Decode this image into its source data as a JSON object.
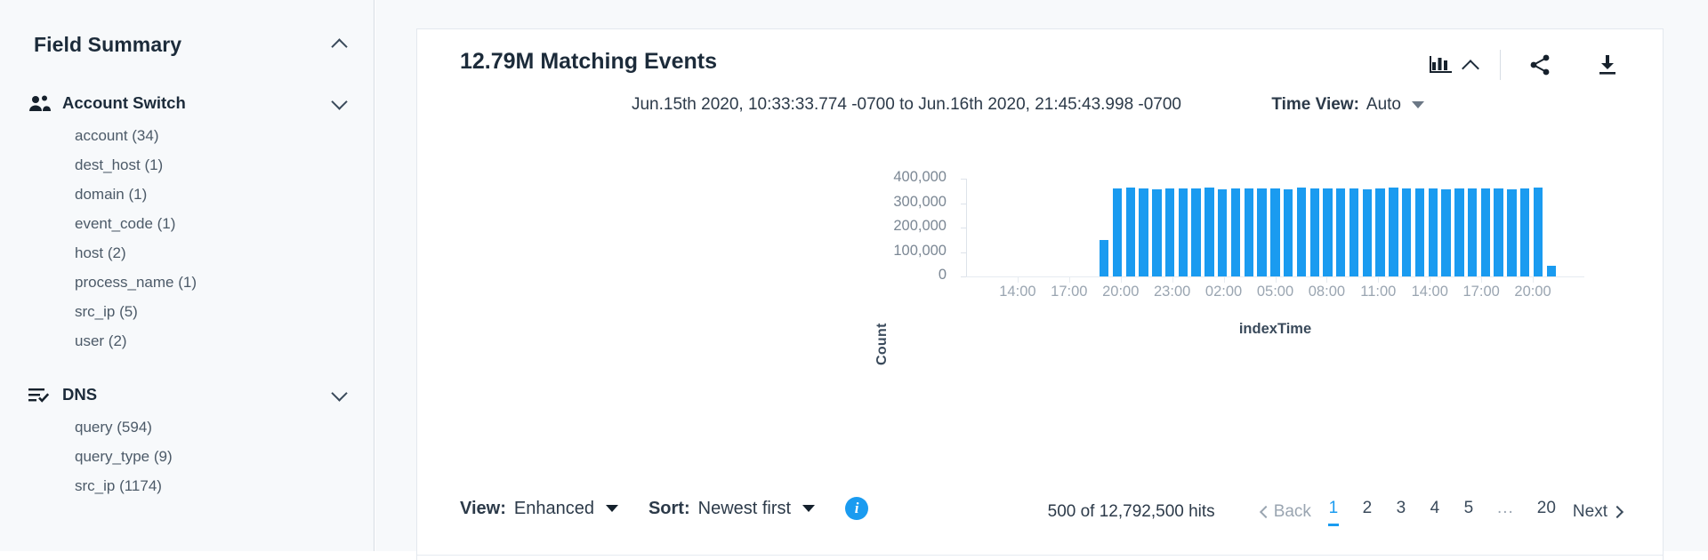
{
  "sidebar": {
    "title": "Field Summary",
    "title_toggle_icon": "chevron-up-icon",
    "groups": [
      {
        "label": "Account Switch",
        "icon": "people-icon",
        "toggle_icon": "chevron-down-icon",
        "fields": [
          "account (34)",
          "dest_host (1)",
          "domain (1)",
          "event_code (1)",
          "host (2)",
          "process_name (1)",
          "src_ip (5)",
          "user (2)"
        ]
      },
      {
        "label": "DNS",
        "icon": "list-check-icon",
        "toggle_icon": "chevron-down-icon",
        "fields": [
          "query (594)",
          "query_type (9)",
          "src_ip (1174)"
        ]
      }
    ]
  },
  "panel": {
    "title": "12.79M Matching Events",
    "tools": [
      {
        "name": "bar-chart-icon",
        "label": ""
      },
      {
        "name": "chevron-up-icon",
        "label": ""
      },
      {
        "name": "share-icon",
        "label": ""
      },
      {
        "name": "download-icon",
        "label": ""
      }
    ],
    "time_range": "Jun.15th 2020, 10:33:33.774 -0700 to Jun.16th 2020, 21:45:43.998 -0700",
    "time_view": {
      "label": "Time View:",
      "value": "Auto"
    }
  },
  "footer": {
    "view": {
      "label": "View:",
      "value": "Enhanced"
    },
    "sort": {
      "label": "Sort:",
      "value": "Newest first"
    },
    "info_icon": "info-icon",
    "info_glyph": "i",
    "hits": "500 of 12,792,500 hits",
    "back": "Back",
    "next": "Next",
    "pages": [
      "1",
      "2",
      "3",
      "4",
      "5",
      "...",
      "20"
    ],
    "current_page": "1"
  },
  "colors": {
    "bar": "#1a9bf0",
    "accent": "#1a9bf0",
    "axis": "#dde3ea",
    "muted_text": "#9aa5b1"
  },
  "chart_data": {
    "type": "bar",
    "title": "",
    "xlabel": "indexTime",
    "ylabel": "Count",
    "ylim": [
      0,
      400000
    ],
    "yticks": [
      "400,000",
      "300,000",
      "200,000",
      "100,000",
      "0"
    ],
    "ytick_values": [
      400000,
      300000,
      200000,
      100000,
      0
    ],
    "grid": false,
    "legend": null,
    "xticks": [
      "14:00",
      "17:00",
      "20:00",
      "23:00",
      "02:00",
      "05:00",
      "08:00",
      "11:00",
      "14:00",
      "17:00",
      "20:00"
    ],
    "x_axis_start": "11:30",
    "x_axis_end": "21:45",
    "slot_count": 47,
    "values": [
      0,
      0,
      0,
      0,
      0,
      0,
      0,
      0,
      0,
      0,
      150000,
      360000,
      362000,
      360000,
      358000,
      361000,
      359000,
      360000,
      362000,
      358000,
      360000,
      361000,
      359000,
      360000,
      358000,
      362000,
      360000,
      359000,
      361000,
      360000,
      358000,
      360000,
      362000,
      359000,
      360000,
      361000,
      358000,
      360000,
      359000,
      361000,
      360000,
      358000,
      360000,
      362000,
      45000,
      0,
      0
    ]
  }
}
